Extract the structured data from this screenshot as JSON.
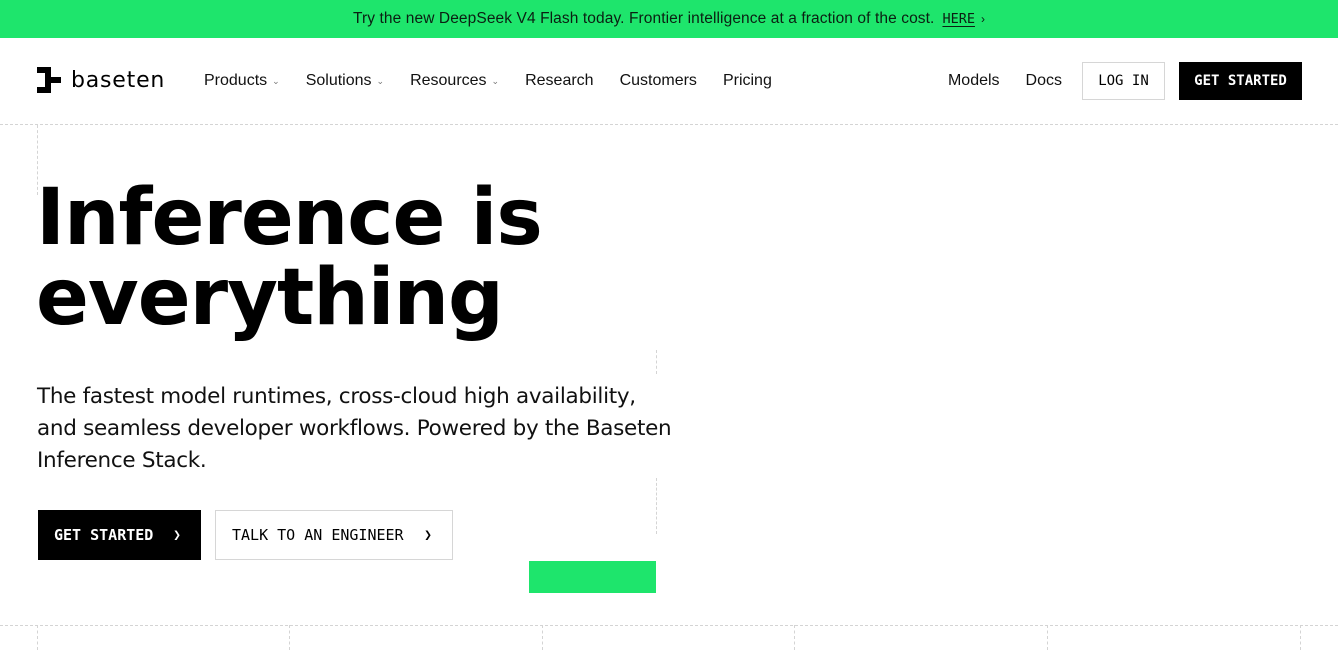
{
  "banner": {
    "message": "Try the new DeepSeek V4 Flash today. Frontier intelligence at a fraction of the cost.",
    "link_label": "HERE",
    "link_icon": "chevron-right-icon",
    "background": "#1ee56c"
  },
  "brand": {
    "name": "baseten",
    "logo_icon": "baseten-logo-icon"
  },
  "nav": {
    "items": [
      {
        "label": "Products",
        "has_dropdown": true
      },
      {
        "label": "Solutions",
        "has_dropdown": true
      },
      {
        "label": "Resources",
        "has_dropdown": true
      },
      {
        "label": "Research",
        "has_dropdown": false
      },
      {
        "label": "Customers",
        "has_dropdown": false
      },
      {
        "label": "Pricing",
        "has_dropdown": false
      }
    ],
    "right": {
      "models": "Models",
      "docs": "Docs",
      "login": "LOG IN",
      "get_started": "GET STARTED"
    }
  },
  "hero": {
    "title_line1": "Inference is",
    "title_line2": "everything",
    "subtitle": "The fastest model runtimes, cross-cloud high availability, and seamless developer workflows. Powered by the Baseten Inference Stack.",
    "primary_cta": "GET STARTED",
    "secondary_cta": "TALK TO AN ENGINEER",
    "accent_color": "#1ee56c"
  }
}
